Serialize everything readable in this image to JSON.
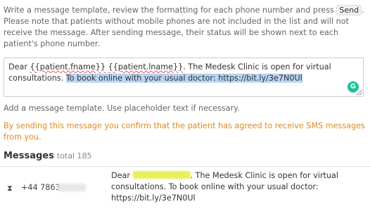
{
  "intro": {
    "text_before": "Write a message template, review the formatting for each phone number and press",
    "send_label": "Send",
    "text_after": ". Please note that patients without mobile phones are not included in the list and will not receive the message. After sending message, their status will be shown next to each patient's phone number."
  },
  "template": {
    "dear": "Dear",
    "fname": "{{patient.fname}}",
    "lname": "{{patient.lname}}",
    "body": ". The Medesk Clinic is open for virtual consultations.",
    "selected": "To book online with your usual doctor: https://bit.ly/3e7N0Ul",
    "grammarly_icon": "G"
  },
  "hint": "Add a message template. Use placeholder text if necessary.",
  "warning": "By sending this message you confirm that the patient has agreed to receive SMS messages from you.",
  "messages": {
    "title": "Messages",
    "total": "total 185",
    "rows": [
      {
        "status_icon": "⧗",
        "phone": "+44 7863",
        "dear": "Dear",
        "text": ". The Medesk Clinic is open for virtual consultations. To book online with your usual doctor: https://bit.ly/3e7N0Ul"
      }
    ]
  },
  "colors": {
    "warning": "#e08a1e",
    "selection": "#b9d4f5",
    "name_highlight": "#e8ef5a"
  }
}
